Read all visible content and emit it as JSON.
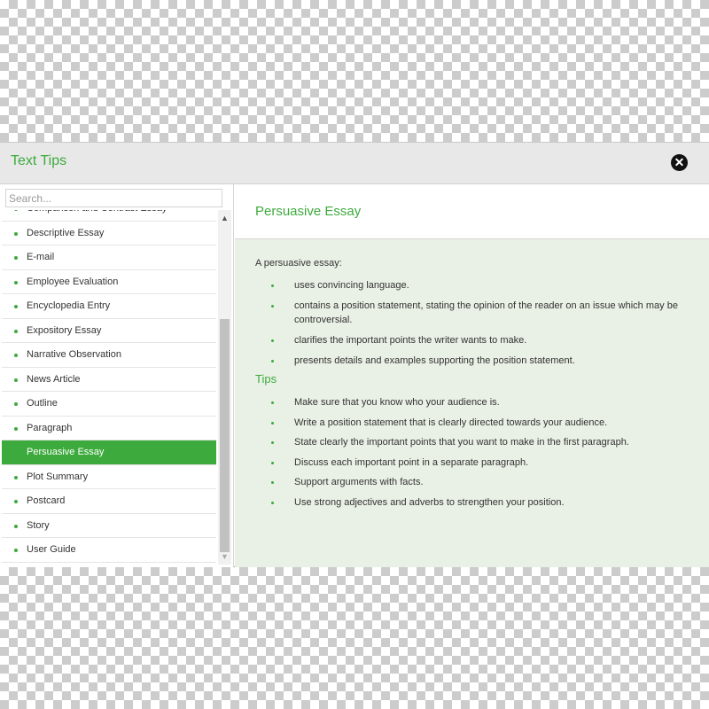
{
  "dialog": {
    "title": "Text Tips",
    "close_icon": "close-icon"
  },
  "sidebar": {
    "search_placeholder": "Search...",
    "items": [
      {
        "label": "Comparison and Contrast Essay"
      },
      {
        "label": "Descriptive Essay"
      },
      {
        "label": "E-mail"
      },
      {
        "label": "Employee Evaluation"
      },
      {
        "label": "Encyclopedia Entry"
      },
      {
        "label": "Expository Essay"
      },
      {
        "label": "Narrative Observation"
      },
      {
        "label": "News Article"
      },
      {
        "label": "Outline"
      },
      {
        "label": "Paragraph"
      },
      {
        "label": "Persuasive Essay",
        "selected": true
      },
      {
        "label": "Plot Summary"
      },
      {
        "label": "Postcard"
      },
      {
        "label": "Story"
      },
      {
        "label": "User Guide"
      }
    ],
    "scroll_up_icon": "▲",
    "scroll_down_icon": "▼"
  },
  "content": {
    "title": "Persuasive Essay",
    "intro": "A persuasive essay:",
    "points": [
      "uses convincing language.",
      "contains a position statement, stating the opinion of the reader on an issue which may be controversial.",
      "clarifies the important points the writer wants to make.",
      "presents details and examples supporting the position statement."
    ],
    "tips_heading": "Tips",
    "tips": [
      "Make sure that you know who your audience is.",
      "Write a position statement that is clearly directed towards your audience.",
      "State clearly the important points that you want to make in the first paragraph.",
      "Discuss each important point in a separate paragraph.",
      "Support arguments with facts.",
      "Use strong adjectives and adverbs to strengthen your position."
    ]
  },
  "colors": {
    "accent": "#3daa3d",
    "content_bg": "#e9f0e5",
    "titlebar_bg": "#e8e8e8"
  }
}
